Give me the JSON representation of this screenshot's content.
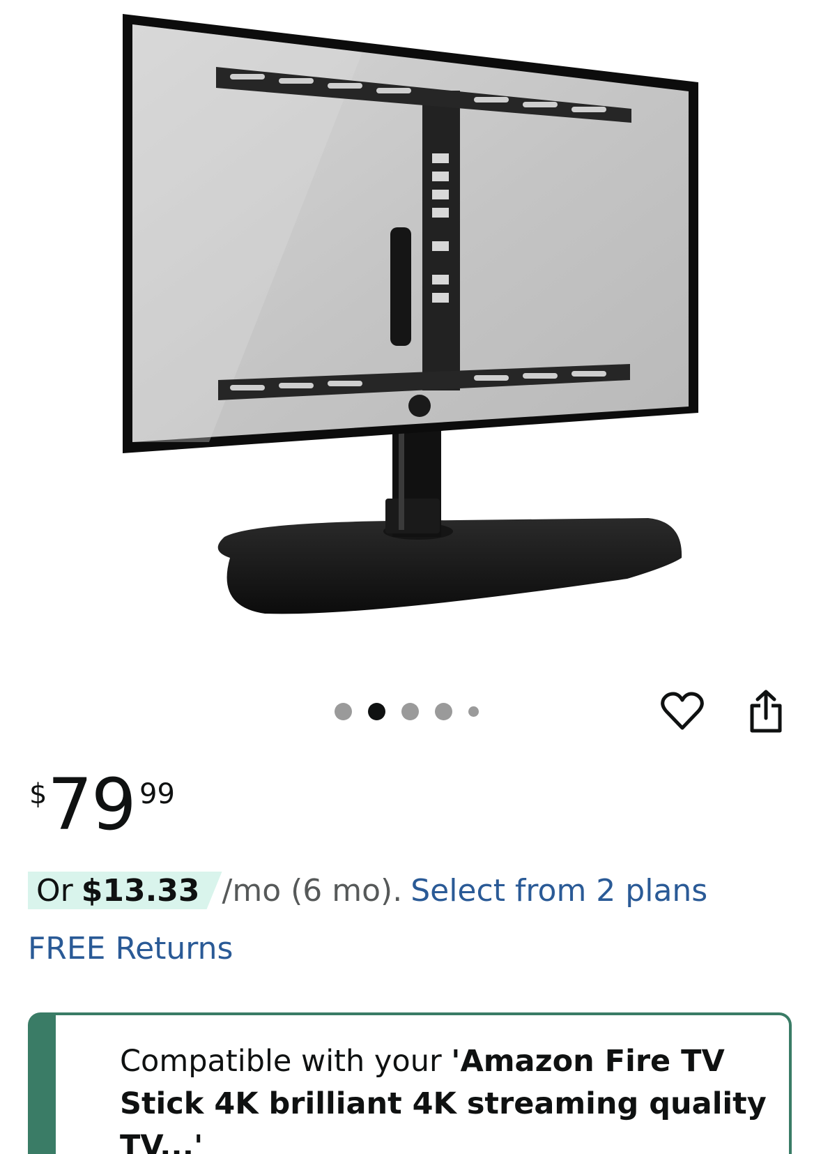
{
  "product": {
    "image_alt": "Swivel tabletop TV stand with mounting bracket holding a TV"
  },
  "carousel": {
    "total": 5,
    "active_index": 1
  },
  "actions": {
    "wishlist_icon": "heart-icon",
    "share_icon": "share-icon"
  },
  "price": {
    "symbol": "$",
    "whole": "79",
    "fraction": "99"
  },
  "installment": {
    "prefix": "Or",
    "amount": "$13.33",
    "term": "/mo (6 mo).",
    "link": "Select from 2 plans"
  },
  "returns": {
    "label": "FREE Returns"
  },
  "compatibility": {
    "prefix": "Compatible with your ",
    "device": "'Amazon Fire TV Stick 4K brilliant 4K streaming quality TV...'"
  },
  "colors": {
    "link": "#2a5a96",
    "badge_bg": "#d9f4ec",
    "compat_border": "#3a7c66"
  }
}
